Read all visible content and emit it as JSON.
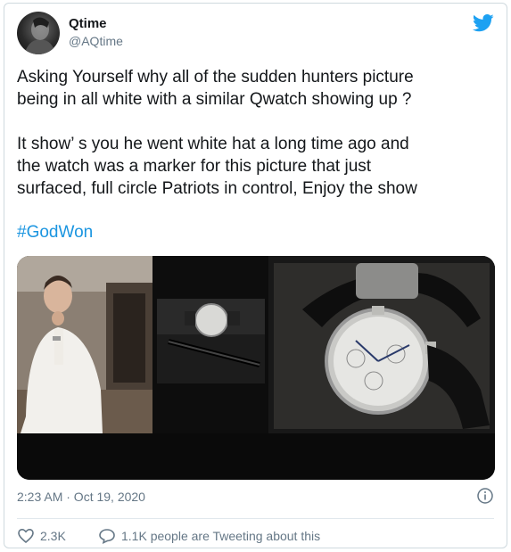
{
  "author": {
    "name": "Qtime",
    "handle": "@AQtime"
  },
  "tweet": {
    "line1": "Asking Yourself why all of the sudden  hunters picture",
    "line2": "being in all white with a similar Qwatch showing up ?",
    "para2_line1": "It show’ s you he went white hat a long time ago and",
    "para2_line2": "the watch was a marker for this picture that just",
    "para2_line3": "surfaced, full circle Patriots in control, Enjoy the show",
    "hashtag": "#GodWon"
  },
  "meta": {
    "timestamp": "2:23 AM · Oct 19, 2020",
    "likes": "2.3K",
    "conversation": "1.1K people are Tweeting about this"
  },
  "colors": {
    "twitter_blue": "#1da1f2",
    "link": "#1b95e0",
    "secondary_text": "#657786"
  },
  "icons": [
    "avatar",
    "twitter-bird-icon",
    "info-icon",
    "heart-icon",
    "speech-bubble-icon"
  ]
}
